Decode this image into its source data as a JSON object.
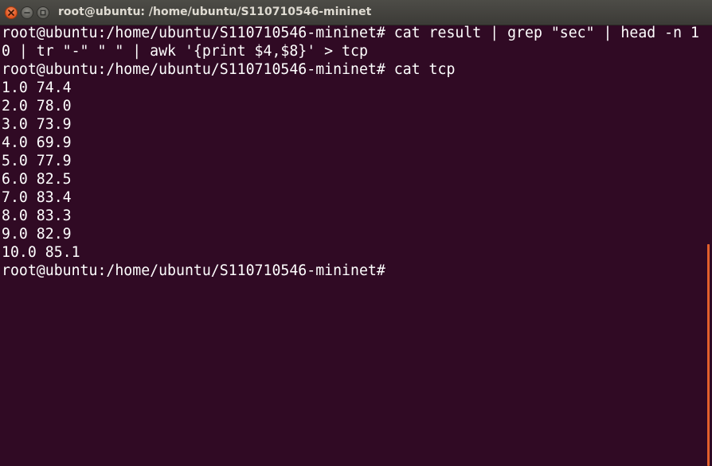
{
  "window": {
    "title": "root@ubuntu: /home/ubuntu/S110710546-mininet"
  },
  "terminal": {
    "lines": [
      "root@ubuntu:/home/ubuntu/S110710546-mininet# cat result | grep \"sec\" | head -n 1",
      "0 | tr \"-\" \" \" | awk '{print $4,$8}' > tcp",
      "root@ubuntu:/home/ubuntu/S110710546-mininet# cat tcp",
      "1.0 74.4",
      "2.0 78.0",
      "3.0 73.9",
      "4.0 69.9",
      "5.0 77.9",
      "6.0 82.5",
      "7.0 83.4",
      "8.0 83.3",
      "9.0 82.9",
      "10.0 85.1",
      "root@ubuntu:/home/ubuntu/S110710546-mininet# "
    ]
  },
  "colors": {
    "terminal_background": "#300a24",
    "text": "#ffffff",
    "close_button": "#e0541f",
    "scrollbar": "#e2602c"
  },
  "icons": {
    "close": "close-icon",
    "minimize": "minimize-icon",
    "maximize": "maximize-icon"
  }
}
